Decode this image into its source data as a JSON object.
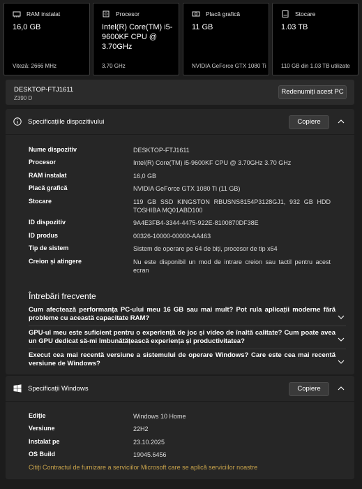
{
  "cards": [
    {
      "title": "RAM instalat",
      "value": "16,0 GB",
      "footer": "Viteză: 2666 MHz",
      "icon": "ram-icon"
    },
    {
      "title": "Procesor",
      "value": "Intel(R) Core(TM) i5-9600KF CPU @ 3.70GHz",
      "footer": "3.70 GHz",
      "icon": "processor-icon"
    },
    {
      "title": "Placă grafică",
      "value": "11 GB",
      "footer": "NVIDIA GeForce GTX 1080 Ti",
      "icon": "graphics-card-icon"
    },
    {
      "title": "Stocare",
      "value": "1.03 TB",
      "footer": "110 GB din 1.03 TB utilizate",
      "icon": "storage-icon"
    }
  ],
  "pc": {
    "name": "DESKTOP-FTJ1611",
    "model": "Z390 D",
    "rename_label": "Redenumiți acest PC"
  },
  "device_specs": {
    "title": "Specificațiile dispozitivului",
    "copy_label": "Copiere",
    "rows": [
      {
        "label": "Nume dispozitiv",
        "value": "DESKTOP-FTJ1611"
      },
      {
        "label": "Procesor",
        "value": "Intel(R) Core(TM) i5-9600KF CPU @ 3.70GHz   3.70 GHz"
      },
      {
        "label": "RAM instalat",
        "value": "16,0 GB"
      },
      {
        "label": "Placă grafică",
        "value": "NVIDIA GeForce GTX 1080 Ti (11 GB)"
      },
      {
        "label": "Stocare",
        "value": "119 GB SSD KINGSTON RBUSNS8154P3128GJ1, 932 GB HDD TOSHIBA MQ01ABD100"
      },
      {
        "label": "ID dispozitiv",
        "value": "9A4E3FB4-3344-4475-922E-8100870DF38E"
      },
      {
        "label": "ID produs",
        "value": "00326-10000-00000-AA463"
      },
      {
        "label": "Tip de sistem",
        "value": "Sistem de operare pe 64 de biți, procesor de tip x64"
      },
      {
        "label": "Creion și atingere",
        "value": "Nu este disponibil un mod de intrare creion sau tactil pentru acest ecran"
      }
    ]
  },
  "faq": {
    "title": "Întrebări frecvente",
    "items": [
      "Cum afectează performanța PC-ului meu 16 GB sau mai mult? Pot rula aplicații moderne fără probleme cu această capacitate RAM?",
      "GPU-ul meu este suficient pentru o experiență de joc și video de înaltă calitate? Cum poate avea un GPU dedicat să-mi îmbunătățească experiența și productivitatea?",
      "Execut cea mai recentă versiune a sistemului de operare Windows? Care este cea mai recentă versiune de Windows?"
    ]
  },
  "windows_specs": {
    "title": "Specificații Windows",
    "copy_label": "Copiere",
    "rows": [
      {
        "label": "Ediție",
        "value": "Windows 10 Home"
      },
      {
        "label": "Versiune",
        "value": "22H2"
      },
      {
        "label": "Instalat pe",
        "value": "23.10.2025"
      },
      {
        "label": "OS Build",
        "value": "19045.6456"
      }
    ],
    "link": "Citiți Contractul de furnizare a serviciilor Microsoft care se aplică serviciilor noastre"
  },
  "colors": {
    "background": "#1c1c1c",
    "card": "#000000",
    "panel": "#262626",
    "link": "#c8a34b",
    "windows_logo": "#ffffff"
  }
}
